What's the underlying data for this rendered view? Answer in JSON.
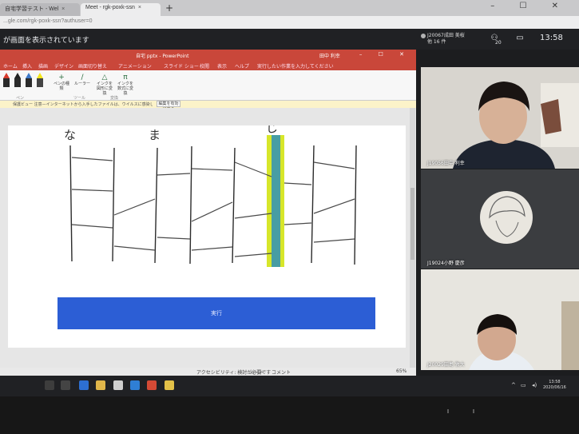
{
  "browser": {
    "tabs": [
      {
        "label": "自宅学習テスト - Wel"
      },
      {
        "label": "Meet - rgk-poxk-ssn"
      }
    ],
    "new_tab": "+",
    "url": "...gle.com/rgk-poxk-ssn?authuser=0"
  },
  "meet": {
    "presenting_text": "が画面を表示されています",
    "self_name": "J20067成田 美桜",
    "self_sub": "他 16 件",
    "participant_count": "20",
    "time": "13:58",
    "participants": [
      {
        "name": "J19056田中 利幸"
      },
      {
        "name": "J19024小野 慶彦"
      },
      {
        "name": "J20029田島 敦大"
      }
    ]
  },
  "powerpoint": {
    "title": "自宅 pptx - PowerPoint",
    "user": "田中 利幸",
    "menu": [
      "ホーム",
      "挿入",
      "描画",
      "デザイン",
      "画面切り替え",
      "アニメーション",
      "スライド ショー",
      "校閲",
      "表示",
      "ヘルプ",
      "実行したい作業を入力してください"
    ],
    "ribbon": {
      "ruler_label": "ルーラー",
      "eraser_label": "ペンの種類",
      "ink_to_shape": "インクを図形に変換",
      "ink_to_math": "インクを数式に変換",
      "group_tools": "ツール",
      "group_pens": "ペン",
      "group_convert": "変換"
    },
    "infobar_text": "保護ビュー 注意—インターネットから入手したファイルは、ウイルスに感染している可能性があります。編集する必要がなければ、保護ビューのままにしておくことをお勧めします。",
    "infobar_button": "編集を有効にする",
    "slide": {
      "labels": [
        "な",
        "ま",
        "じ"
      ],
      "button_text": "実行"
    },
    "status": {
      "notes": "ノート",
      "comments": "コメント",
      "accessibility": "アクセシビリティ: 検討が必要です",
      "zoom": "65%"
    }
  },
  "taskbar": {
    "time": "13:58",
    "date": "2020/06/16"
  },
  "colors": {
    "ppt_red": "#c9473a",
    "slide_button": "#2c5ed5",
    "highlight": "#d7e62a",
    "highlight_ink": "#2e8fb8",
    "meet_dark": "#202124"
  },
  "icons": {
    "participants": "people-icon",
    "chat": "chat-icon",
    "mic": "mic-icon"
  }
}
